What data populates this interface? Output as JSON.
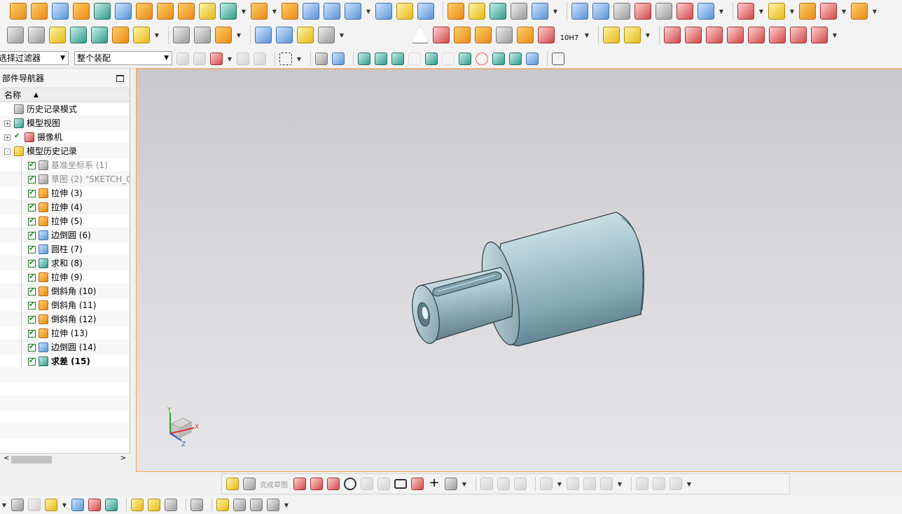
{
  "toolbar": {
    "selection_filter": "选择过滤器",
    "assembly_scope": "整个装配",
    "tolerance_label": "10H7",
    "finish_sketch": "完成草图"
  },
  "navigator": {
    "title": "部件导航器",
    "column_name": "名称",
    "items": [
      {
        "label": "历史记录模式",
        "indent": 0,
        "expander": "",
        "icon": "clock-icon",
        "checked": false,
        "dim": false,
        "bold": false
      },
      {
        "label": "模型视图",
        "indent": 0,
        "expander": "+",
        "icon": "model-view-icon",
        "checked": false,
        "dim": false,
        "bold": false
      },
      {
        "label": "摄像机",
        "indent": 0,
        "expander": "+",
        "icon": "camera-icon",
        "checked": true,
        "dim": false,
        "bold": false
      },
      {
        "label": "模型历史记录",
        "indent": 0,
        "expander": "-",
        "icon": "folder-icon",
        "checked": false,
        "dim": false,
        "bold": false
      },
      {
        "label": "基准坐标系 (1)",
        "indent": 1,
        "expander": "",
        "icon": "datum-csys-icon",
        "checked": true,
        "dim": true,
        "bold": false
      },
      {
        "label": "草图 (2) \"SKETCH_0",
        "indent": 1,
        "expander": "",
        "icon": "sketch-icon",
        "checked": true,
        "dim": true,
        "bold": false
      },
      {
        "label": "拉伸 (3)",
        "indent": 1,
        "expander": "",
        "icon": "extrude-icon",
        "checked": true,
        "dim": false,
        "bold": false
      },
      {
        "label": "拉伸 (4)",
        "indent": 1,
        "expander": "",
        "icon": "extrude-icon",
        "checked": true,
        "dim": false,
        "bold": false
      },
      {
        "label": "拉伸 (5)",
        "indent": 1,
        "expander": "",
        "icon": "extrude-icon",
        "checked": true,
        "dim": false,
        "bold": false
      },
      {
        "label": "边倒圆 (6)",
        "indent": 1,
        "expander": "",
        "icon": "edge-blend-icon",
        "checked": true,
        "dim": false,
        "bold": false
      },
      {
        "label": "圆柱 (7)",
        "indent": 1,
        "expander": "",
        "icon": "cylinder-icon",
        "checked": true,
        "dim": false,
        "bold": false
      },
      {
        "label": "求和 (8)",
        "indent": 1,
        "expander": "",
        "icon": "unite-icon",
        "checked": true,
        "dim": false,
        "bold": false
      },
      {
        "label": "拉伸 (9)",
        "indent": 1,
        "expander": "",
        "icon": "extrude-icon",
        "checked": true,
        "dim": false,
        "bold": false
      },
      {
        "label": "倒斜角 (10)",
        "indent": 1,
        "expander": "",
        "icon": "chamfer-icon",
        "checked": true,
        "dim": false,
        "bold": false
      },
      {
        "label": "倒斜角 (11)",
        "indent": 1,
        "expander": "",
        "icon": "chamfer-icon",
        "checked": true,
        "dim": false,
        "bold": false
      },
      {
        "label": "倒斜角 (12)",
        "indent": 1,
        "expander": "",
        "icon": "chamfer-icon",
        "checked": true,
        "dim": false,
        "bold": false
      },
      {
        "label": "拉伸 (13)",
        "indent": 1,
        "expander": "",
        "icon": "extrude-icon",
        "checked": true,
        "dim": false,
        "bold": false
      },
      {
        "label": "边倒圆 (14)",
        "indent": 1,
        "expander": "",
        "icon": "edge-blend-icon",
        "checked": true,
        "dim": false,
        "bold": false
      },
      {
        "label": "求差 (15)",
        "indent": 1,
        "expander": "",
        "icon": "subtract-icon",
        "checked": true,
        "dim": false,
        "bold": true
      }
    ]
  },
  "triad": {
    "x": "X",
    "y": "Y",
    "z": "Z"
  },
  "colors": {
    "viewport_top": "#c9c9cb",
    "viewport_bottom": "#e6e6e8",
    "part": "#a9c6cf",
    "accent_border": "#ff9c3a"
  }
}
